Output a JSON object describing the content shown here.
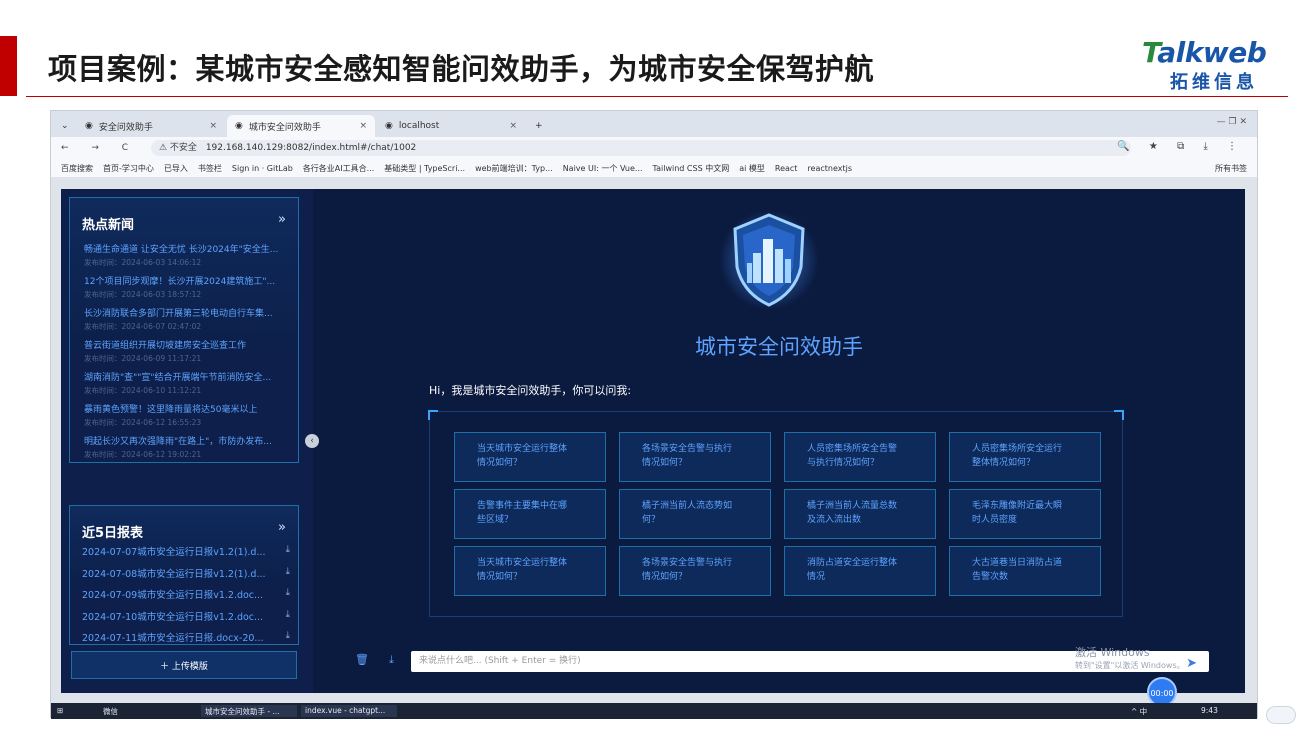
{
  "slide": {
    "title": "项目案例：某城市安全感知智能问效助手，为城市安全保驾护航",
    "logo_word_t": "T",
    "logo_word_rest": "alkweb",
    "logo_cn": "拓维信息"
  },
  "browser": {
    "tabs": [
      {
        "label": "安全问效助手",
        "close": "×"
      },
      {
        "label": "城市安全问效助手",
        "close": "×"
      },
      {
        "label": "localhost",
        "close": "×"
      }
    ],
    "new_tab": "+",
    "tab_menu": "⌄",
    "window_controls": "—   ❐   ✕",
    "nav_controls": "← → C ⌂",
    "url_warning": "⚠ 不安全",
    "url": "192.168.140.129:8082/index.html#/chat/1002",
    "addr_right": "🔍 ★ ⧉ ⤓ ⋮",
    "bookmarks": [
      "百度搜索",
      "首页-学习中心",
      "已导入",
      "书签栏",
      "Sign in · GitLab",
      "各行各业AI工具合...",
      "基础类型 | TypeScri...",
      "web前端培训：Typ...",
      "Naive UI: 一个 Vue...",
      "Tailwind CSS 中文网",
      "ai 模型",
      "React",
      "reactnextjs"
    ],
    "bookmarks_right": "所有书签"
  },
  "news": {
    "heading": "热点新闻",
    "more": "»",
    "items": [
      {
        "title": "畅通生命通道 让安全无忧 长沙2024年\"安全生...",
        "time": "发布时间：2024-06-03 14:06:12"
      },
      {
        "title": "12个项目同步观摩！长沙开展2024建筑施工\"...",
        "time": "发布时间：2024-06-03 18:57:12"
      },
      {
        "title": "长沙消防联合多部门开展第三轮电动自行车集...",
        "time": "发布时间：2024-06-07 02:47:02"
      },
      {
        "title": "普云街道组织开展切坡建房安全巡查工作",
        "time": "发布时间：2024-06-09 11:17:21"
      },
      {
        "title": "湖南消防\"查\"\"宣\"结合开展端午节前消防安全...",
        "time": "发布时间：2024-06-10 11:12:21"
      },
      {
        "title": "暴雨黄色预警！这里降雨量将达50毫米以上",
        "time": "发布时间：2024-06-12 16:55:23"
      },
      {
        "title": "明起长沙又再次强降雨\"在路上\"，市防办发布...",
        "time": "发布时间：2024-06-12 19:02:21"
      }
    ]
  },
  "reports": {
    "heading": "近5日报表",
    "more": "»",
    "download_icon": "⤓",
    "items": [
      "2024-07-07城市安全运行日报v1.2(1).d...",
      "2024-07-08城市安全运行日报v1.2(1).d...",
      "2024-07-09城市安全运行日报v1.2.doc...",
      "2024-07-10城市安全运行日报v1.2.doc...",
      "2024-07-11城市安全运行日报.docx-20..."
    ],
    "upload_label": "＋ 上传模版"
  },
  "collapse_icon": "‹",
  "assistant": {
    "title": "城市安全问效助手",
    "greeting": "Hi，我是城市安全问效助手，你可以问我:",
    "suggestions": [
      "当天城市安全运行整体\n情况如何？",
      "各场景安全告警与执行\n情况如何？",
      "人员密集场所安全告警\n与执行情况如何？",
      "人员密集场所安全运行\n整体情况如何？",
      "告警事件主要集中在哪\n些区域？",
      "橘子洲当前人流态势如\n何？",
      "橘子洲当前人流量总数\n及流入流出数",
      "毛泽东雕像附近最大瞬\n时人员密度",
      "当天城市安全运行整体\n情况如何？",
      "各场景安全告警与执行\n情况如何？",
      "消防占道安全运行整体\n情况",
      "大古道巷当日消防占道\n告警次数"
    ],
    "input_placeholder": "来说点什么吧... (Shift + Enter = 换行)",
    "delete_icon": "🗑",
    "download_icon": "⤓",
    "send_icon": "➤",
    "activate_line1": "激活 Windows",
    "activate_line2": "转到\"设置\"以激活 Windows。",
    "timer": "00:00"
  },
  "taskbar": {
    "start": "⊞",
    "wechat": "微信",
    "chrome_task": "城市安全问效助手 - ...",
    "vscode_task": "index.vue - chatgpt...",
    "tray": "^ 中",
    "time": "9:43"
  }
}
